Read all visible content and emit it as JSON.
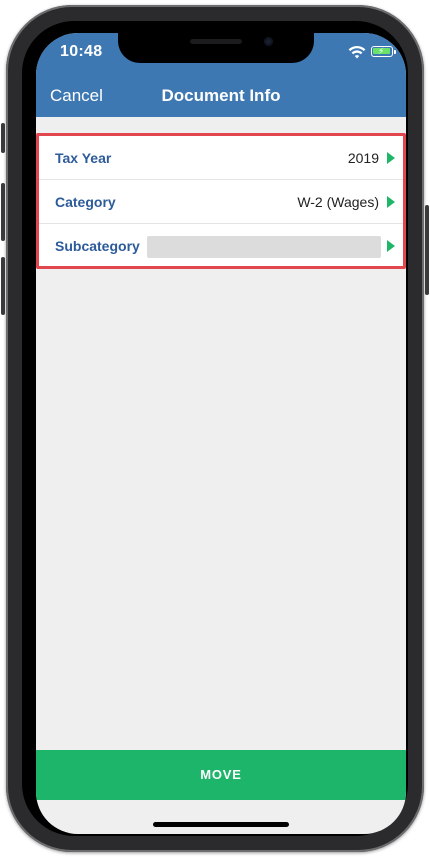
{
  "status_bar": {
    "time": "10:48"
  },
  "nav": {
    "cancel_label": "Cancel",
    "title": "Document Info"
  },
  "form": {
    "rows": [
      {
        "label": "Tax Year",
        "value": "2019"
      },
      {
        "label": "Category",
        "value": "W-2 (Wages)"
      },
      {
        "label": "Subcategory",
        "value": ""
      }
    ]
  },
  "actions": {
    "move_label": "MOVE"
  },
  "colors": {
    "header": "#3e78b3",
    "label": "#2d5b9a",
    "accent_green": "#1db56a",
    "highlight_red": "#e2464f"
  },
  "icons": [
    "wifi-icon",
    "battery-icon",
    "disclosure-arrow-icon"
  ]
}
